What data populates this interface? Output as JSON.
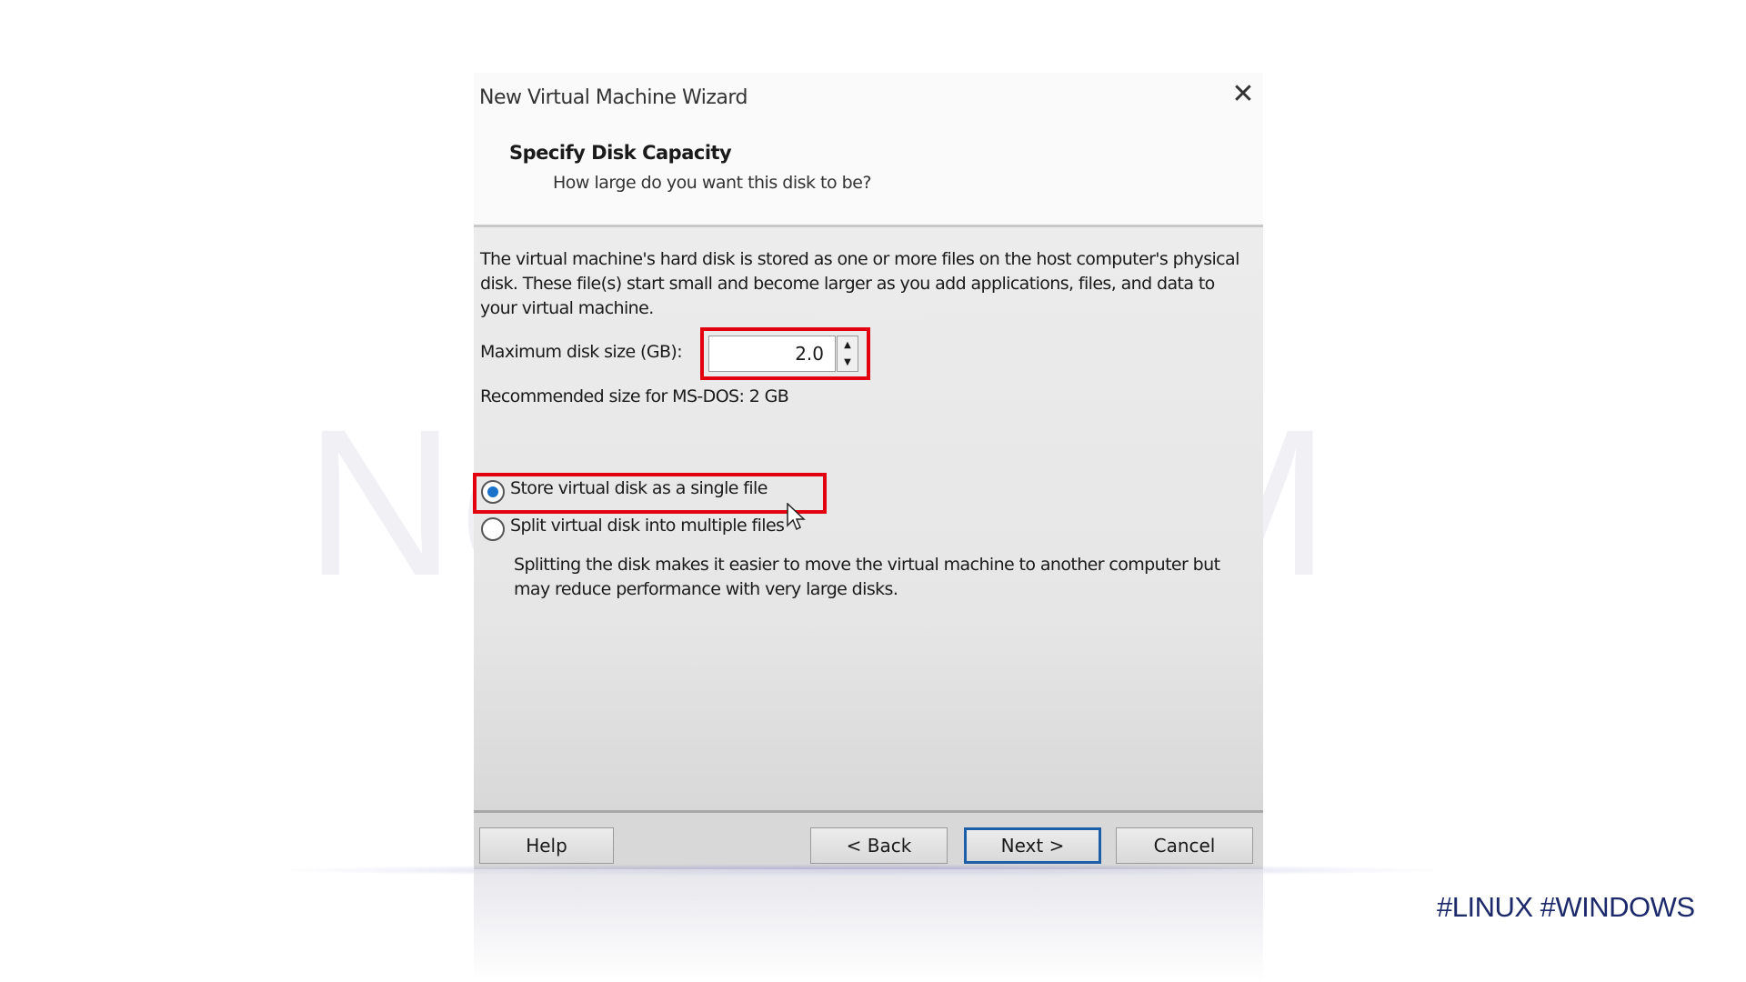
{
  "dialog": {
    "title": "New Virtual Machine Wizard",
    "heading": "Specify Disk Capacity",
    "subheading": "How large do you want this disk to be?",
    "description": "The virtual machine's hard disk is stored as one or more files on the host computer's physical disk. These file(s) start small and become larger as you add applications, files, and data to your virtual machine.",
    "max_size_label": "Maximum disk size (GB):",
    "max_size_value": "2.0",
    "recommended": "Recommended size for MS-DOS: 2 GB",
    "options": [
      {
        "label": "Store virtual disk as a single file",
        "selected": true
      },
      {
        "label": "Split virtual disk into multiple files",
        "selected": false
      }
    ],
    "split_note": "Splitting the disk makes it easier to move the virtual machine to another computer but may reduce performance with very large disks.",
    "buttons": {
      "help": "Help",
      "back": "< Back",
      "next": "Next >",
      "cancel": "Cancel"
    }
  },
  "watermark": "NeuronVM",
  "tags": "#LINUX #WINDOWS",
  "colors": {
    "highlight": "#e3000f",
    "accent": "#1c5fa8",
    "tags": "#1c2a6b"
  }
}
